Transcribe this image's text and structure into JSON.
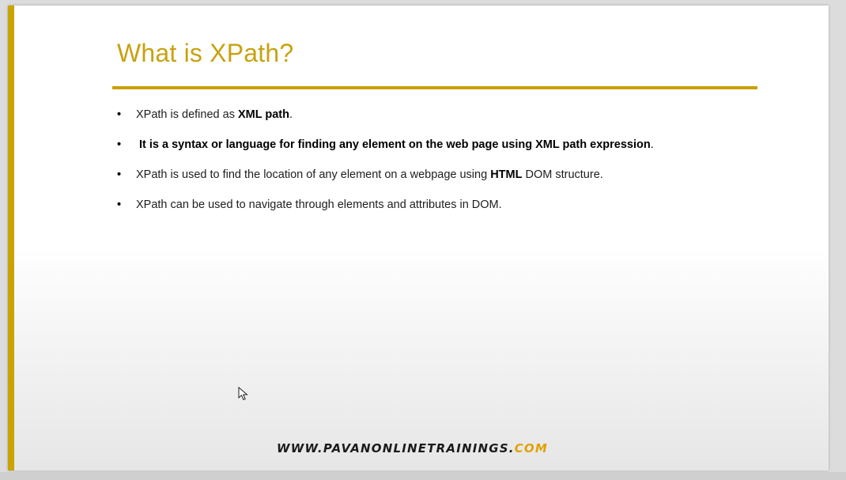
{
  "slide": {
    "title": "What is XPath?",
    "accent_color": "#c9a000",
    "bullets": [
      {
        "pre": "XPath is defined as ",
        "bold": "XML path",
        "post": "."
      },
      {
        "text": "It is a syntax or language for finding any element on the web page using XML path expression",
        "post": "."
      },
      {
        "pre": "XPath is used to find the location of any element on a webpage using ",
        "bold": "HTML",
        "post": " DOM structure."
      },
      {
        "pre": "XPath can be used to navigate through elements and attributes in DOM.",
        "bold": "",
        "post": ""
      }
    ],
    "bullet_glyph": "•",
    "footer": {
      "main": "WWW.PAVANONLINETRAININGS.",
      "accent": "COM"
    }
  },
  "icons": {
    "cursor": "mouse-pointer-icon"
  }
}
